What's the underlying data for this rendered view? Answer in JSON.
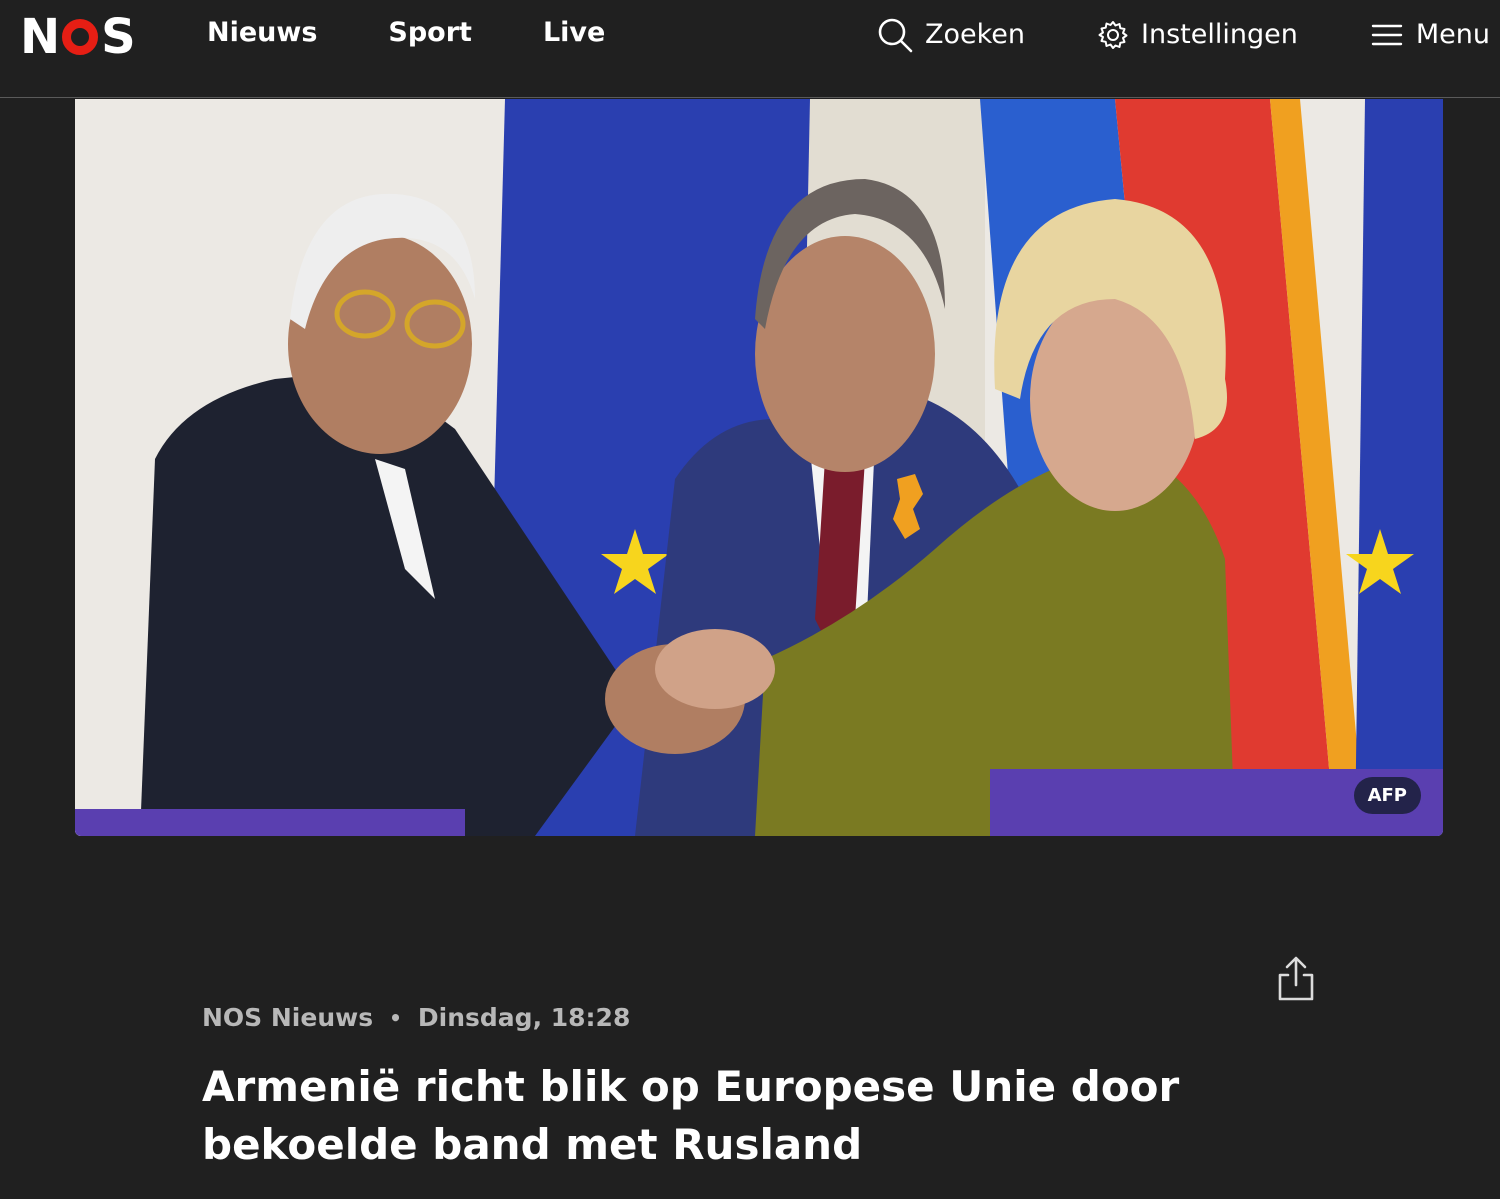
{
  "header": {
    "logo": "NOS",
    "nav": [
      "Nieuws",
      "Sport",
      "Live"
    ],
    "search_label": "Zoeken",
    "settings_label": "Instellingen",
    "menu_label": "Menu"
  },
  "hero": {
    "credit": "AFP"
  },
  "article": {
    "source": "NOS Nieuws",
    "separator": "•",
    "timestamp": "Dinsdag, 18:28",
    "headline": "Armenië richt blik op Europese Unie door bekoelde band met Rusland"
  },
  "colors": {
    "background": "#202020",
    "brand_red": "#e61e14",
    "credit_badge": "#23234a",
    "meta_text": "#b8b8b8"
  },
  "icons": [
    "search-icon",
    "gear-icon",
    "hamburger-icon",
    "share-icon"
  ]
}
